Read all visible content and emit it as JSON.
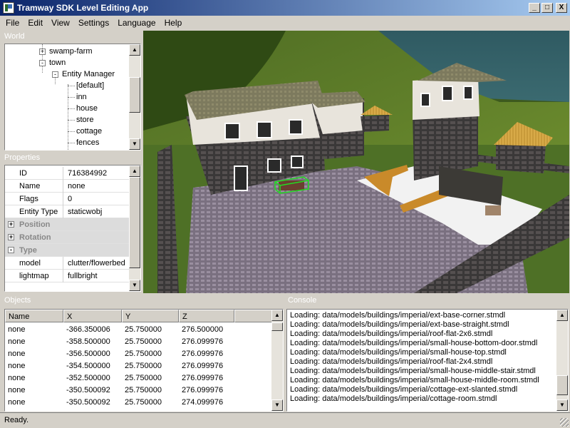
{
  "window": {
    "title": "Tramway SDK Level Editing App",
    "minimize": "_",
    "maximize": "□",
    "close": "X"
  },
  "menu": [
    "File",
    "Edit",
    "View",
    "Settings",
    "Language",
    "Help"
  ],
  "world_panel": {
    "title": "World",
    "tree": [
      {
        "label": "swamp-farm",
        "expander": "+"
      },
      {
        "label": "town",
        "expander": "-"
      },
      {
        "label": "Entity Manager",
        "expander": "-"
      },
      {
        "label": "[default]"
      },
      {
        "label": "inn"
      },
      {
        "label": "house"
      },
      {
        "label": "store"
      },
      {
        "label": "cottage"
      },
      {
        "label": "fences"
      }
    ]
  },
  "properties_panel": {
    "title": "Properties",
    "rows": [
      {
        "key": "ID",
        "value": "716384992"
      },
      {
        "key": "Name",
        "value": "none"
      },
      {
        "key": "Flags",
        "value": "0"
      },
      {
        "key": "Entity Type",
        "value": "staticwobj"
      }
    ],
    "groups": [
      {
        "label": "Position",
        "expander": "+"
      },
      {
        "label": "Rotation",
        "expander": "+"
      },
      {
        "label": "Type",
        "expander": "-"
      }
    ],
    "type_rows": [
      {
        "key": "model",
        "value": "clutter/flowerbed"
      },
      {
        "key": "lightmap",
        "value": "fullbright"
      }
    ]
  },
  "objects_panel": {
    "title": "Objects",
    "columns": [
      "Name",
      "X",
      "Y",
      "Z"
    ],
    "rows": [
      [
        "none",
        "-366.350006",
        "25.750000",
        "276.500000"
      ],
      [
        "none",
        "-358.500000",
        "25.750000",
        "276.099976"
      ],
      [
        "none",
        "-356.500000",
        "25.750000",
        "276.099976"
      ],
      [
        "none",
        "-354.500000",
        "25.750000",
        "276.099976"
      ],
      [
        "none",
        "-352.500000",
        "25.750000",
        "276.099976"
      ],
      [
        "none",
        "-350.500092",
        "25.750000",
        "276.099976"
      ],
      [
        "none",
        "-350.500092",
        "25.750000",
        "274.099976"
      ]
    ]
  },
  "console_panel": {
    "title": "Console",
    "lines": [
      "Loading: data/models/buildings/imperial/ext-base-corner.stmdl",
      "Loading: data/models/buildings/imperial/ext-base-straight.stmdl",
      "Loading: data/models/buildings/imperial/roof-flat-2x6.stmdl",
      "Loading: data/models/buildings/imperial/small-house-bottom-door.stmdl",
      "Loading: data/models/buildings/imperial/small-house-top.stmdl",
      "Loading: data/models/buildings/imperial/roof-flat-2x4.stmdl",
      "Loading: data/models/buildings/imperial/small-house-middle-stair.stmdl",
      "Loading: data/models/buildings/imperial/small-house-middle-room.stmdl",
      "Loading: data/models/buildings/imperial/cottage-ext-slanted.stmdl",
      "Loading: data/models/buildings/imperial/cottage-room.stmdl"
    ]
  },
  "status": {
    "text": "Ready."
  },
  "colors": {
    "titlebar_start": "#0a246a",
    "titlebar_end": "#a6caf0",
    "chrome": "#d4d0c8",
    "selection_box": "#22dd22"
  }
}
